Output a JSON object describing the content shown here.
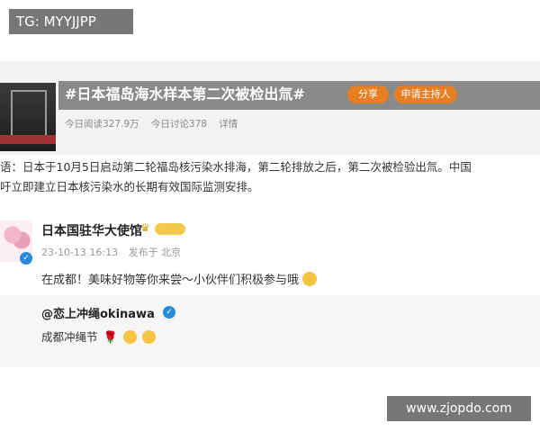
{
  "overlay": {
    "tg_label": "TG: MYYJJPP",
    "watermark": "www.zjopdo.com"
  },
  "topic": {
    "title": "#日本福岛海水样本第二次被检出氚#",
    "share_label": "分享",
    "host_label": "申请主持人",
    "reads": "今日阅读327.9万",
    "discussions": "今日讨论378",
    "details": "详情"
  },
  "description": {
    "line1": "语：日本于10月5日启动第二轮福岛核污染水排海，第二轮排放之后，第二次被检验出氚。中国",
    "line2": "吁立即建立日本核污染水的长期有效国际监测安排。"
  },
  "post": {
    "author": "日本国驻华大使馆",
    "date": "23-10-13 16:13",
    "source": "发布于 北京",
    "text": "在成都！美味好物等你来尝～小伙伴们积极参与哦"
  },
  "repost": {
    "author": "@恋上冲绳okinawa",
    "text": "成都冲绳节"
  },
  "icons": {
    "verified": "verified-icon",
    "crown": "crown-icon",
    "rose": "rose-icon",
    "heart_eyes": "heart-eyes-icon"
  },
  "colors": {
    "accent": "#e67e22",
    "verified": "#2a8bd8"
  }
}
